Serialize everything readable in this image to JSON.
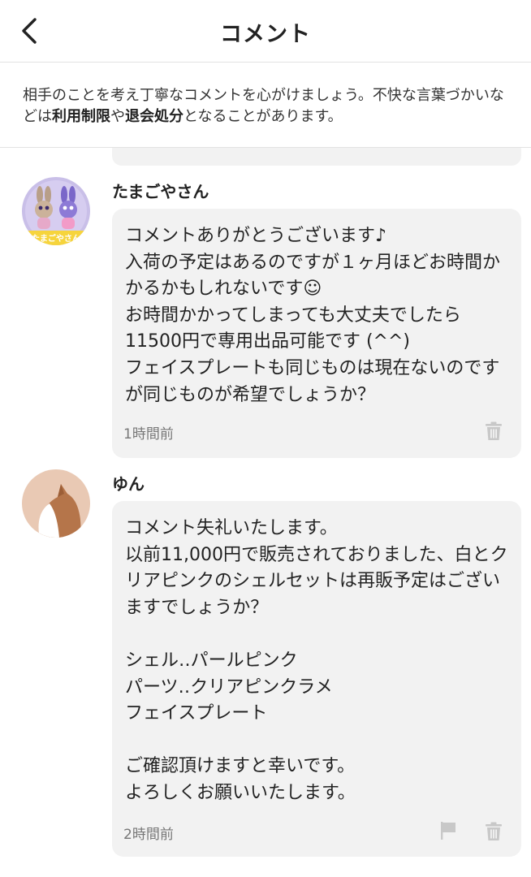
{
  "header": {
    "title": "コメント"
  },
  "notice": {
    "text_1": "相手のことを考え丁寧なコメントを心がけましょう。不快な言葉づかいなどは",
    "bold_1": "利用制限",
    "text_2": "や",
    "bold_2": "退会処分",
    "text_3": "となることがあります。"
  },
  "comments": [
    {
      "username": "たまごやさん",
      "avatar_text": "たまごやさん",
      "body": "コメントありがとうございます♪\n入荷の予定はあるのですが１ヶ月ほどお時間かかるかもしれないです☺\nお時間かかってしまっても大丈夫でしたら11500円で専用出品可能です (^^)\nフェイスプレートも同じものは現在ないのですが同じものが希望でしょうか？",
      "time": "1時間前",
      "icons": [
        "trash-icon"
      ]
    },
    {
      "username": "ゆん",
      "body": "コメント失礼いたします。\n以前11,000円で販売されておりました、白とクリアピンクのシェルセットは再販予定はございますでしょうか？\n\nシェル‥パールピンク\nパーツ‥クリアピンクラメ\nフェイスプレート\n\nご確認頂けますと幸いです。\nよろしくお願いいたします。",
      "time": "2時間前",
      "icons": [
        "flag-icon",
        "trash-icon"
      ]
    }
  ],
  "colors": {
    "bubble": "#f2f2f2",
    "divider": "#e3e3e3",
    "icon_gray": "#c8c8c8",
    "avatar1_bg": "#c9bfe8",
    "avatar2_bg": "#e9c9b4"
  }
}
